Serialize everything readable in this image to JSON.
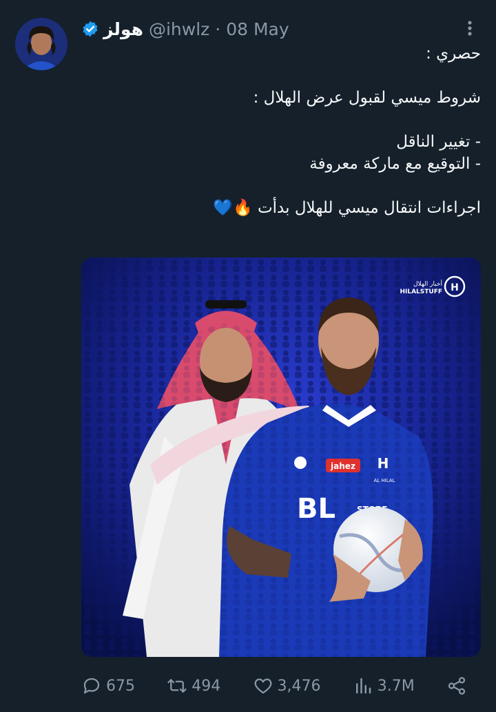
{
  "tweet": {
    "author": {
      "display_name": "هولز",
      "handle": "@ihwlz",
      "verified": true
    },
    "separator": "·",
    "date": "08 May",
    "text_lines": [
      "حصري :",
      "",
      "شروط ميسي لقبول عرض الهلال :",
      "",
      "- تغيير الناقل",
      "- التوقيع مع ماركة معروفة",
      "",
      "اجراءات انتقال ميسي للهلال بدأت 🔥💙"
    ],
    "media": {
      "watermark_top": "أخبار الهلال",
      "watermark_bottom": "HILALSTUFF",
      "sponsor": "jahez",
      "shirt_text": "STORE",
      "badge_text": "AL HILAL"
    },
    "stats": {
      "replies": "675",
      "retweets": "494",
      "likes": "3,476",
      "views": "3.7M"
    }
  },
  "colors": {
    "background": "#15202b",
    "muted": "#8b98a5",
    "verified": "#1d9bf0",
    "hilal_blue": "#1a3ab8"
  }
}
